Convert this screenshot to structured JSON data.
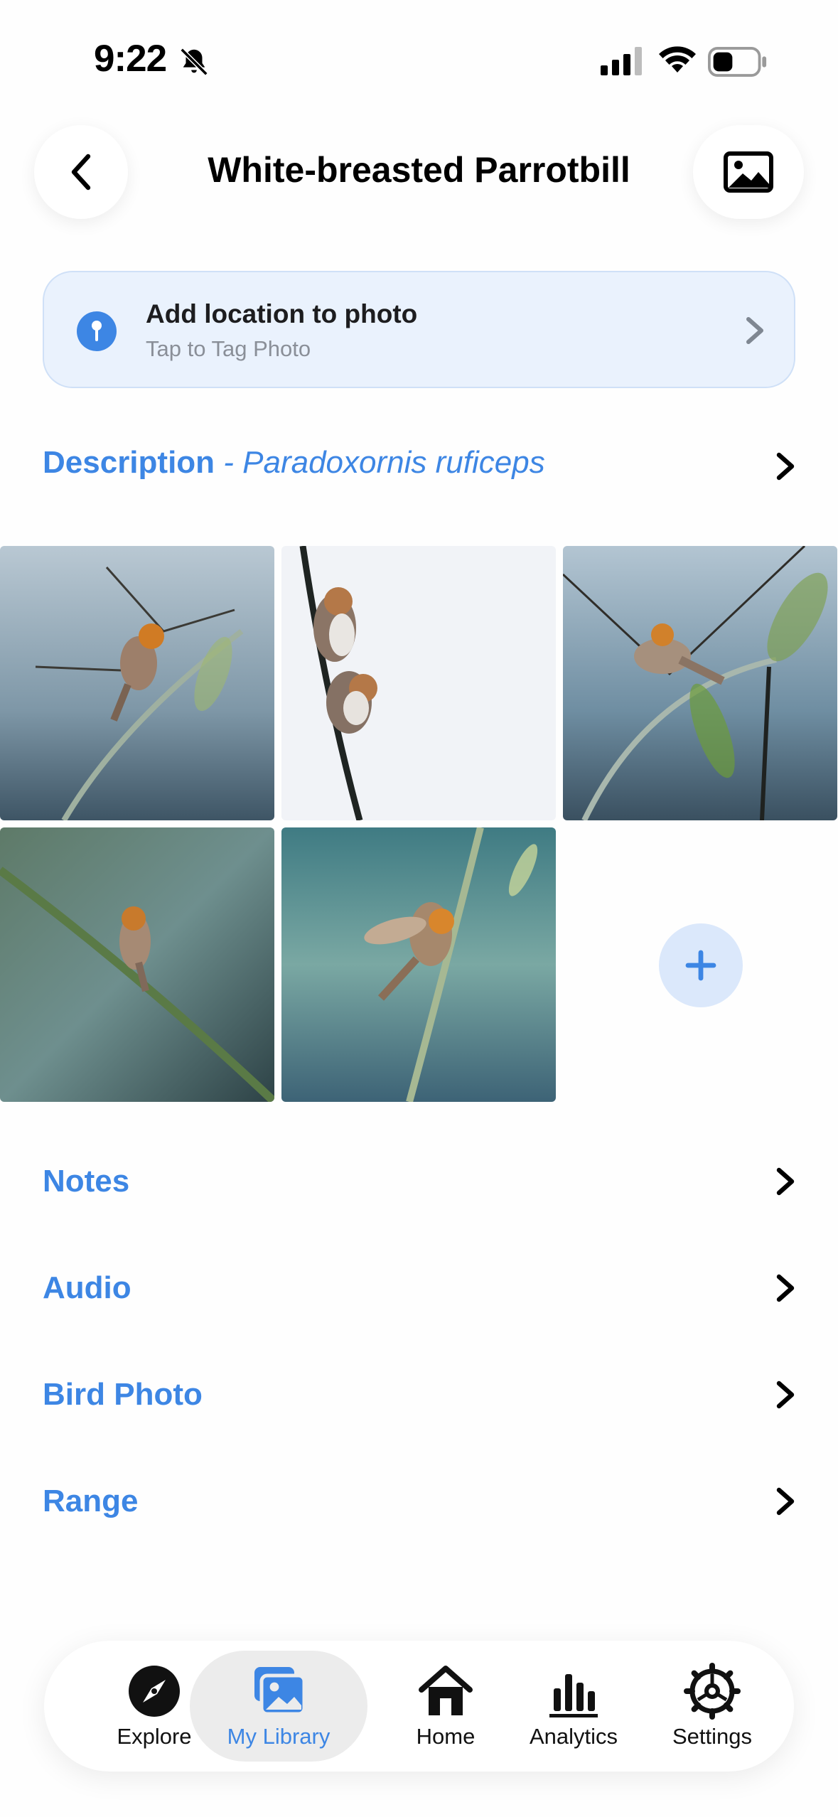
{
  "status_bar": {
    "time": "9:22",
    "icons": [
      "bell-slash-icon",
      "signal-icon",
      "wifi-icon",
      "battery-icon"
    ]
  },
  "header": {
    "title": "White-breasted Parrotbill",
    "back_icon": "chevron-left-icon",
    "photo_icon": "photo-icon"
  },
  "location_card": {
    "title": "Add location to photo",
    "subtitle": "Tap to Tag Photo",
    "icon": "pin-icon"
  },
  "description": {
    "label": "Description",
    "scientific_name": " - Paradoxornis ruficeps"
  },
  "photos": {
    "count": 5,
    "add_icon": "plus-icon"
  },
  "sections": [
    {
      "label": "Notes"
    },
    {
      "label": "Audio"
    },
    {
      "label": "Bird Photo"
    },
    {
      "label": "Range"
    }
  ],
  "tab_bar": {
    "items": [
      {
        "label": "Explore",
        "icon": "compass-icon"
      },
      {
        "label": "My Library",
        "icon": "photo-library-icon",
        "active": true
      },
      {
        "label": "Home",
        "icon": "home-icon"
      },
      {
        "label": "Analytics",
        "icon": "bar-chart-icon"
      },
      {
        "label": "Settings",
        "icon": "gear-icon"
      }
    ]
  },
  "colors": {
    "accent": "#3d86e4",
    "card_background": "#eaf2fd"
  }
}
